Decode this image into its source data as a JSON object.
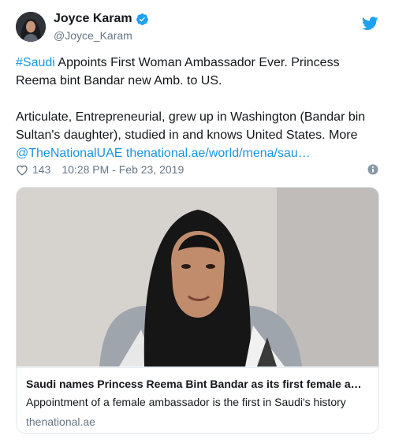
{
  "author": {
    "display_name": "Joyce Karam",
    "handle": "@Joyce_Karam"
  },
  "tweet": {
    "line1_hashtag": "#Saudi",
    "line1_text": " Appoints First Woman Ambassador Ever. Princess Reema bint Bandar new Amb. to US.",
    "para2_text": "Articulate, Entrepreneurial, grew up in Washington (Bandar bin Sultan's daughter), studied in and knows United States. More ",
    "mention": "@TheNationalUAE",
    "url": "thenational.ae/world/mena/sau…"
  },
  "meta": {
    "likes": "143",
    "timestamp": "10:28 PM - Feb 23, 2019"
  },
  "card": {
    "title": "Saudi names Princess Reema Bint Bandar as its first female ambassador",
    "description": "Appointment of a female ambassador is the first in Saudi's history",
    "domain": "thenational.ae"
  },
  "colors": {
    "link": "#1b95e0",
    "verified": "#1da1f2",
    "secondary_text": "#657786",
    "border": "#e1e8ed"
  },
  "icons": {
    "verified": "verified-badge-icon",
    "bird": "twitter-bird-icon",
    "heart": "heart-icon",
    "info": "info-icon"
  }
}
